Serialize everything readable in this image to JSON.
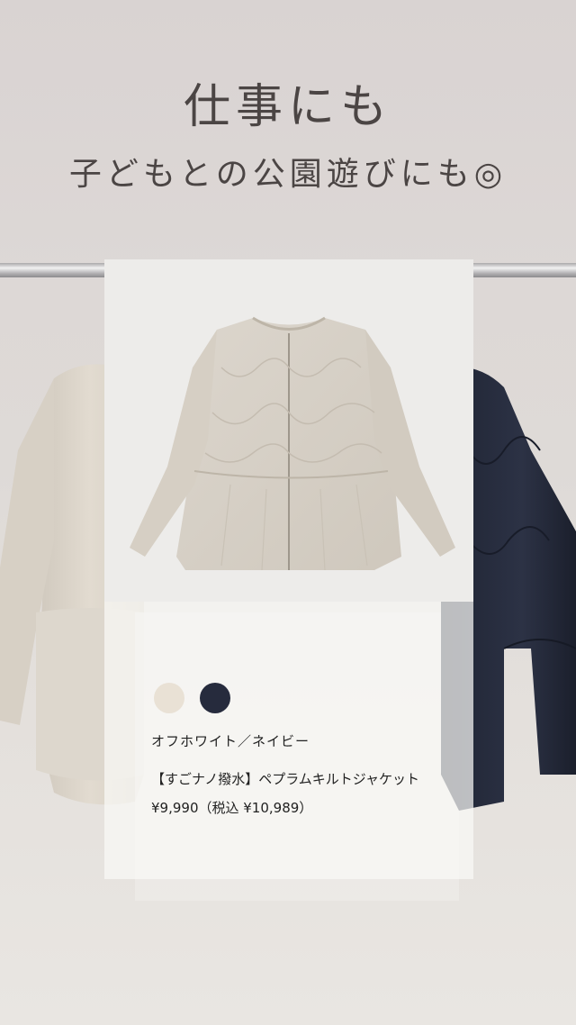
{
  "headline": {
    "line1": "仕事にも",
    "line2": "子どもとの公園遊びにも◎"
  },
  "product": {
    "colors_text": "オフホワイト／ネイビー",
    "name": "【すごナノ撥水】ペプラムキルトジャケット",
    "price": "¥9,990（税込 ¥10,989）",
    "swatches": [
      {
        "name": "off-white",
        "color": "#e9e1d5"
      },
      {
        "name": "navy",
        "color": "#262b3d"
      }
    ]
  }
}
